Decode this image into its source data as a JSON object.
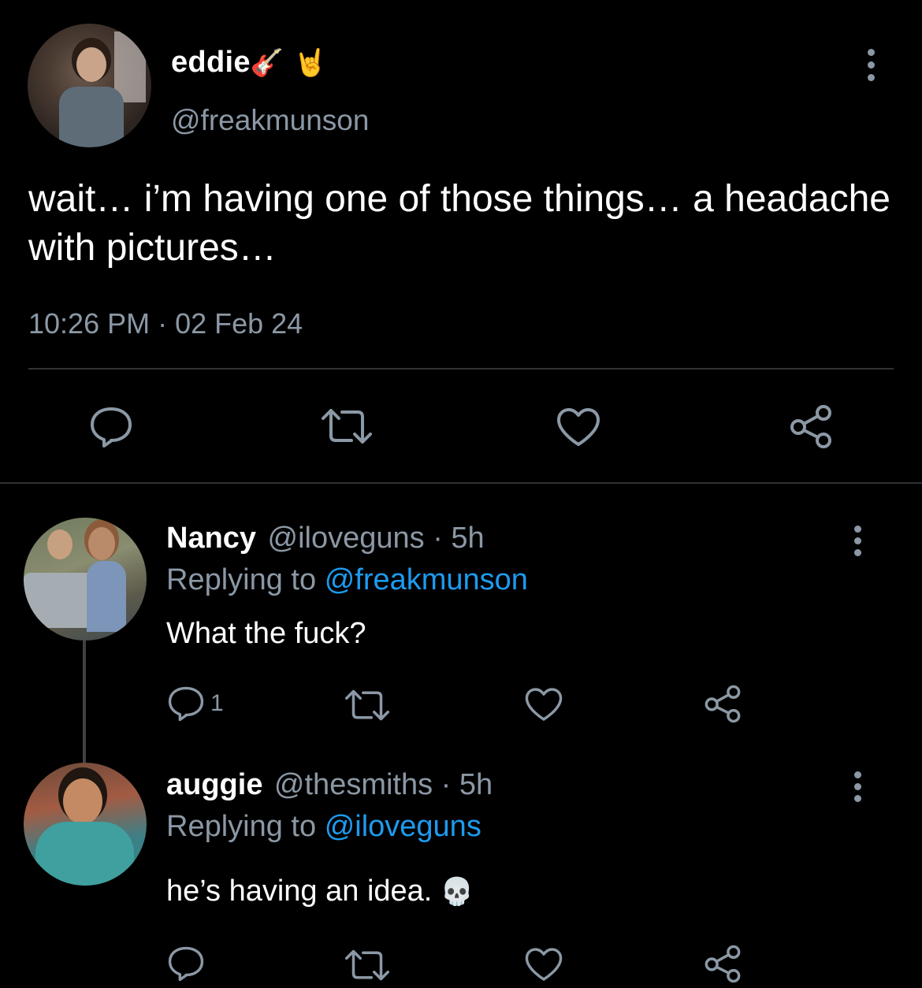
{
  "tweet": {
    "display_name": "eddie",
    "name_emojis": "🎸 🤘",
    "handle": "@freakmunson",
    "text": "wait… i’m having one of those things… a headache with pictures…",
    "timestamp": "10:26 PM · 02 Feb 24",
    "actions": [
      "reply-icon",
      "retweet-icon",
      "like-icon",
      "share-icon"
    ]
  },
  "replies": [
    {
      "name": "Nancy",
      "meta": "@iloveguns · 5h",
      "replying_prefix": "Replying to",
      "replying_to": "@freakmunson",
      "text": "What the fuck?",
      "reply_count": "1"
    },
    {
      "name": "auggie",
      "meta": "@thesmiths · 5h",
      "replying_prefix": "Replying to",
      "replying_to": "@iloveguns",
      "text": "he’s having an idea.",
      "text_emoji": "💀",
      "reply_count": ""
    }
  ],
  "colors": {
    "background": "#000000",
    "text": "#ffffff",
    "secondary": "#8b98a5",
    "link": "#1d9bf0",
    "divider": "#2f3336"
  }
}
